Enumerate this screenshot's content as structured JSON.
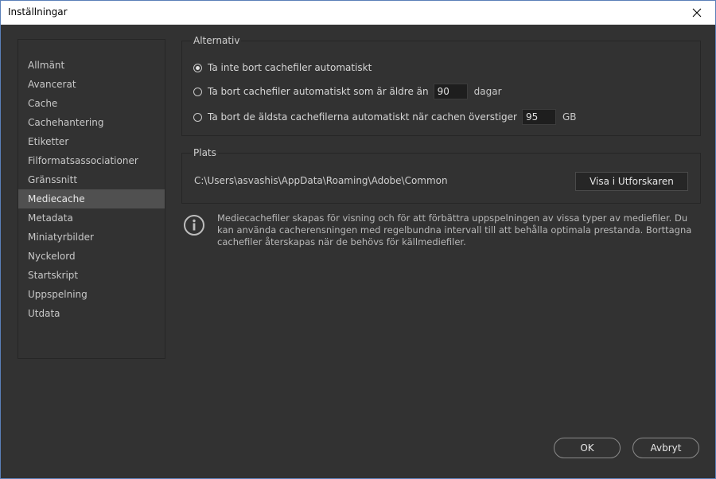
{
  "window": {
    "title": "Inställningar"
  },
  "sidebar": {
    "items": [
      {
        "label": "Allmänt"
      },
      {
        "label": "Avancerat"
      },
      {
        "label": "Cache"
      },
      {
        "label": "Cachehantering"
      },
      {
        "label": "Etiketter"
      },
      {
        "label": "Filformatsassociationer"
      },
      {
        "label": "Gränssnitt"
      },
      {
        "label": "Mediecache"
      },
      {
        "label": "Metadata"
      },
      {
        "label": "Miniatyrbilder"
      },
      {
        "label": "Nyckelord"
      },
      {
        "label": "Startskript"
      },
      {
        "label": "Uppspelning"
      },
      {
        "label": "Utdata"
      }
    ],
    "selected": "Mediecache"
  },
  "options": {
    "group_title": "Alternativ",
    "radio_1": "Ta inte bort cachefiler automatiskt",
    "radio_2": "Ta bort cachefiler automatiskt som är äldre än",
    "radio_2_value": "90",
    "radio_2_unit": "dagar",
    "radio_3": "Ta bort de äldsta cachefilerna automatiskt när cachen överstiger",
    "radio_3_value": "95",
    "radio_3_unit": "GB",
    "selected_option": "radio_1"
  },
  "location": {
    "group_title": "Plats",
    "path": "C:\\Users\\asvashis\\AppData\\Roaming\\Adobe\\Common",
    "show_button": "Visa i Utforskaren"
  },
  "info": {
    "icon": "info-icon",
    "text": "Mediecachefiler skapas för visning och för att förbättra uppspelningen av vissa typer av mediefiler. Du kan använda cacherensningen med regelbundna intervall till att behålla optimala prestanda. Borttagna cachefiler återskapas när de behövs för källmediefiler."
  },
  "footer": {
    "ok": "OK",
    "cancel": "Avbryt"
  },
  "colors": {
    "background": "#323232",
    "selected_item": "#505050",
    "border": "#262626"
  }
}
